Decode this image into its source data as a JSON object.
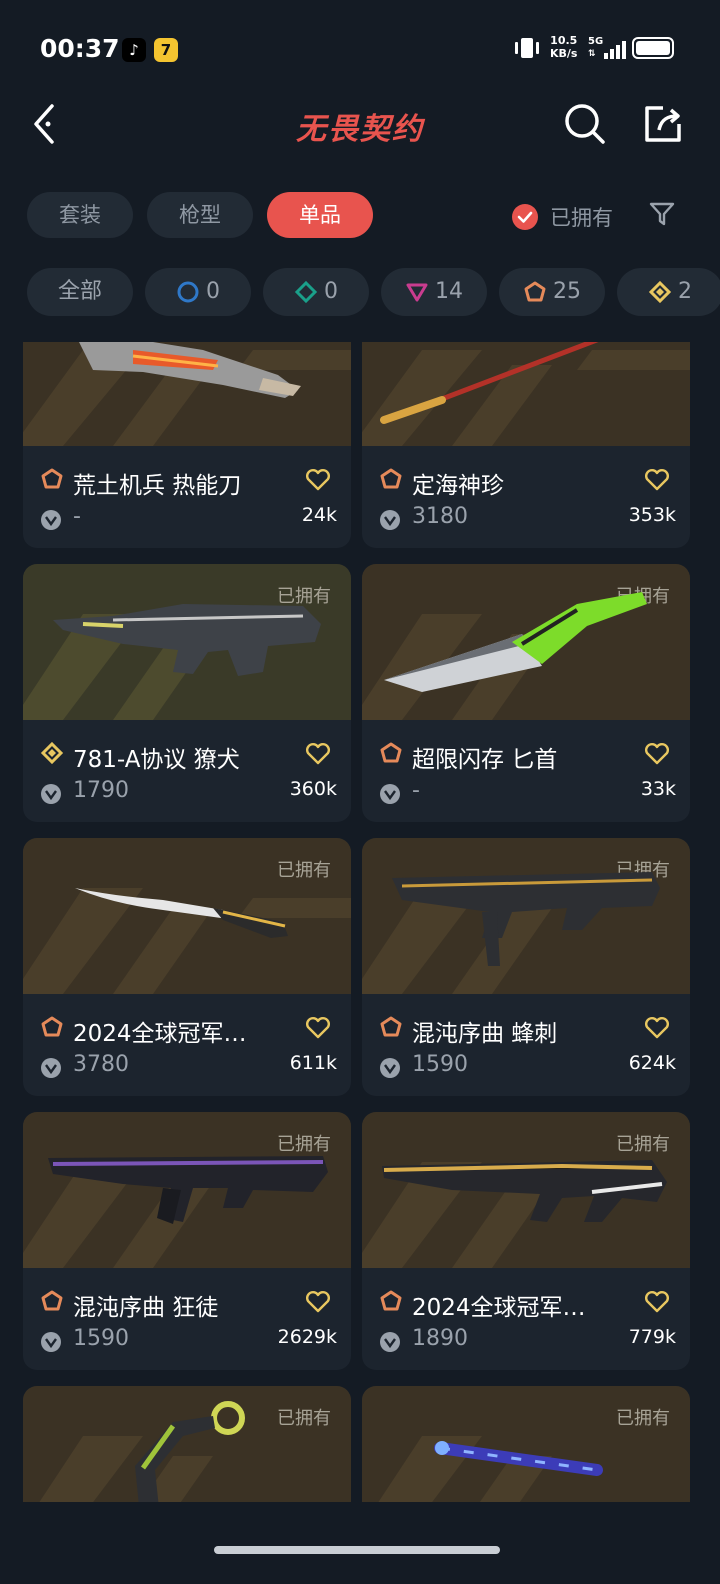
{
  "status_bar": {
    "time": "00:37",
    "speed_value": "10.5",
    "speed_unit": "KB/s",
    "network": "5G"
  },
  "header": {
    "title": "无畏契约",
    "back_icon": "chevron-left-icon",
    "search_icon": "search-icon",
    "share_icon": "share-icon"
  },
  "tabs": [
    {
      "label": "套装",
      "active": false
    },
    {
      "label": "枪型",
      "active": false
    },
    {
      "label": "单品",
      "active": true
    }
  ],
  "owned_filter": {
    "label": "已拥有",
    "checked": true
  },
  "chips": [
    {
      "label": "全部"
    },
    {
      "label": "0",
      "tier": "select",
      "color": "#2f78c8"
    },
    {
      "label": "0",
      "tier": "deluxe",
      "color": "#1aa08a"
    },
    {
      "label": "14",
      "tier": "premium",
      "color": "#c93c8f"
    },
    {
      "label": "25",
      "tier": "exclusive",
      "color": "#e58a5a"
    },
    {
      "label": "2",
      "tier": "ultra",
      "color": "#e8c760"
    }
  ],
  "owned_tag": "已拥有",
  "items": [
    {
      "name": "荒土机兵 热能刀",
      "tier": "exclusive",
      "price": "-",
      "likes": "24k",
      "owned": false
    },
    {
      "name": "定海神珍",
      "tier": "exclusive",
      "price": "3180",
      "likes": "353k",
      "owned": false
    },
    {
      "name": "781-A协议 獠犬",
      "tier": "ultra",
      "price": "1790",
      "likes": "360k",
      "owned": true
    },
    {
      "name": "超限闪存 匕首",
      "tier": "exclusive",
      "price": "-",
      "likes": "33k",
      "owned": true
    },
    {
      "name": "2024全球冠军…",
      "tier": "exclusive",
      "price": "3780",
      "likes": "611k",
      "owned": true
    },
    {
      "name": "混沌序曲 蜂刺",
      "tier": "exclusive",
      "price": "1590",
      "likes": "624k",
      "owned": true
    },
    {
      "name": "混沌序曲 狂徒",
      "tier": "exclusive",
      "price": "1590",
      "likes": "2629k",
      "owned": true
    },
    {
      "name": "2024全球冠军…",
      "tier": "exclusive",
      "price": "1890",
      "likes": "779k",
      "owned": true
    },
    {
      "name": "",
      "tier": "exclusive",
      "price": "",
      "likes": "",
      "owned": true
    },
    {
      "name": "",
      "tier": "exclusive",
      "price": "",
      "likes": "",
      "owned": true
    }
  ],
  "colors": {
    "accent": "#e8544e",
    "background": "#141b24",
    "card": "#1c242e",
    "exclusive": "#e58a5a",
    "ultra": "#e8c760"
  }
}
